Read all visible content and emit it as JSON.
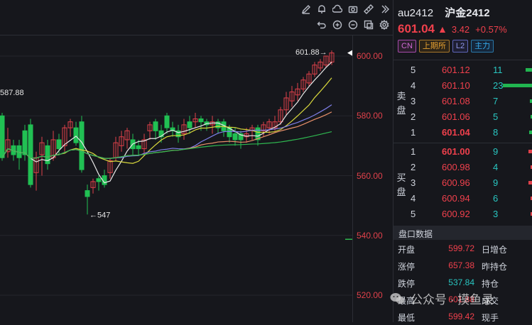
{
  "toolbar": {
    "row1_icons": [
      "pencil-icon",
      "bell-icon",
      "cloud-icon",
      "camera-icon",
      "ruler-icon",
      "collapse-icon"
    ],
    "row2_icons": [
      "undo-icon",
      "zoom-in-icon",
      "zoom-out-icon",
      "fit-icon",
      "settings-icon"
    ]
  },
  "chart": {
    "y_ticks": [
      "600.00",
      "580.00",
      "560.00",
      "540.00",
      "520.00"
    ],
    "y_values": [
      600,
      580,
      560,
      540,
      520
    ],
    "high_annotation": "601.88→",
    "low_annotation": "←547",
    "left_annotation": "587.88",
    "colors": {
      "up": "#e0414a",
      "down": "#21c053",
      "ma5": "#e8e8e8",
      "ma10": "#d8d83c",
      "ma20": "#7f7fe8",
      "ma30": "#e8906a",
      "ma60": "#2fb850"
    }
  },
  "instrument": {
    "code": "au2412",
    "name": "沪金2412",
    "last": "601.04",
    "arrow": "🡅",
    "change": "3.42",
    "change_pct": "+0.57%",
    "tags": [
      "CN",
      "上期所",
      "L2",
      "主力"
    ]
  },
  "order_book": {
    "ask_label": "卖盘",
    "bid_label": "买盘",
    "asks": [
      {
        "level": "5",
        "price": "601.12",
        "vol": "11",
        "bar": 0.25
      },
      {
        "level": "4",
        "price": "601.10",
        "vol": "23",
        "bar": 1.0
      },
      {
        "level": "3",
        "price": "601.08",
        "vol": "7",
        "bar": 0.1
      },
      {
        "level": "2",
        "price": "601.06",
        "vol": "5",
        "bar": 0.08
      },
      {
        "level": "1",
        "price": "601.04",
        "vol": "8",
        "bar": 0.12
      }
    ],
    "bids": [
      {
        "level": "1",
        "price": "601.00",
        "vol": "9",
        "bar": 0.14
      },
      {
        "level": "2",
        "price": "600.98",
        "vol": "4",
        "bar": 0.06
      },
      {
        "level": "3",
        "price": "600.96",
        "vol": "9",
        "bar": 0.14
      },
      {
        "level": "4",
        "price": "600.94",
        "vol": "6",
        "bar": 0.08
      },
      {
        "level": "5",
        "price": "600.92",
        "vol": "3",
        "bar": 0.05
      }
    ]
  },
  "stats": {
    "title": "盘口数据",
    "rows": [
      {
        "k1": "开盘",
        "v1": "599.72",
        "c1": "red",
        "k2": "日增仓"
      },
      {
        "k1": "涨停",
        "v1": "657.38",
        "c1": "red",
        "k2": "昨持仓"
      },
      {
        "k1": "跌停",
        "v1": "537.84",
        "c1": "cyan",
        "k2": "持仓"
      },
      {
        "k1": "最高",
        "v1": "601.88",
        "c1": "red",
        "k2": "成交"
      },
      {
        "k1": "最低",
        "v1": "599.42",
        "c1": "red",
        "k2": "现手"
      }
    ]
  },
  "watermark": {
    "text": "公众号 · 摸鱼录"
  }
}
